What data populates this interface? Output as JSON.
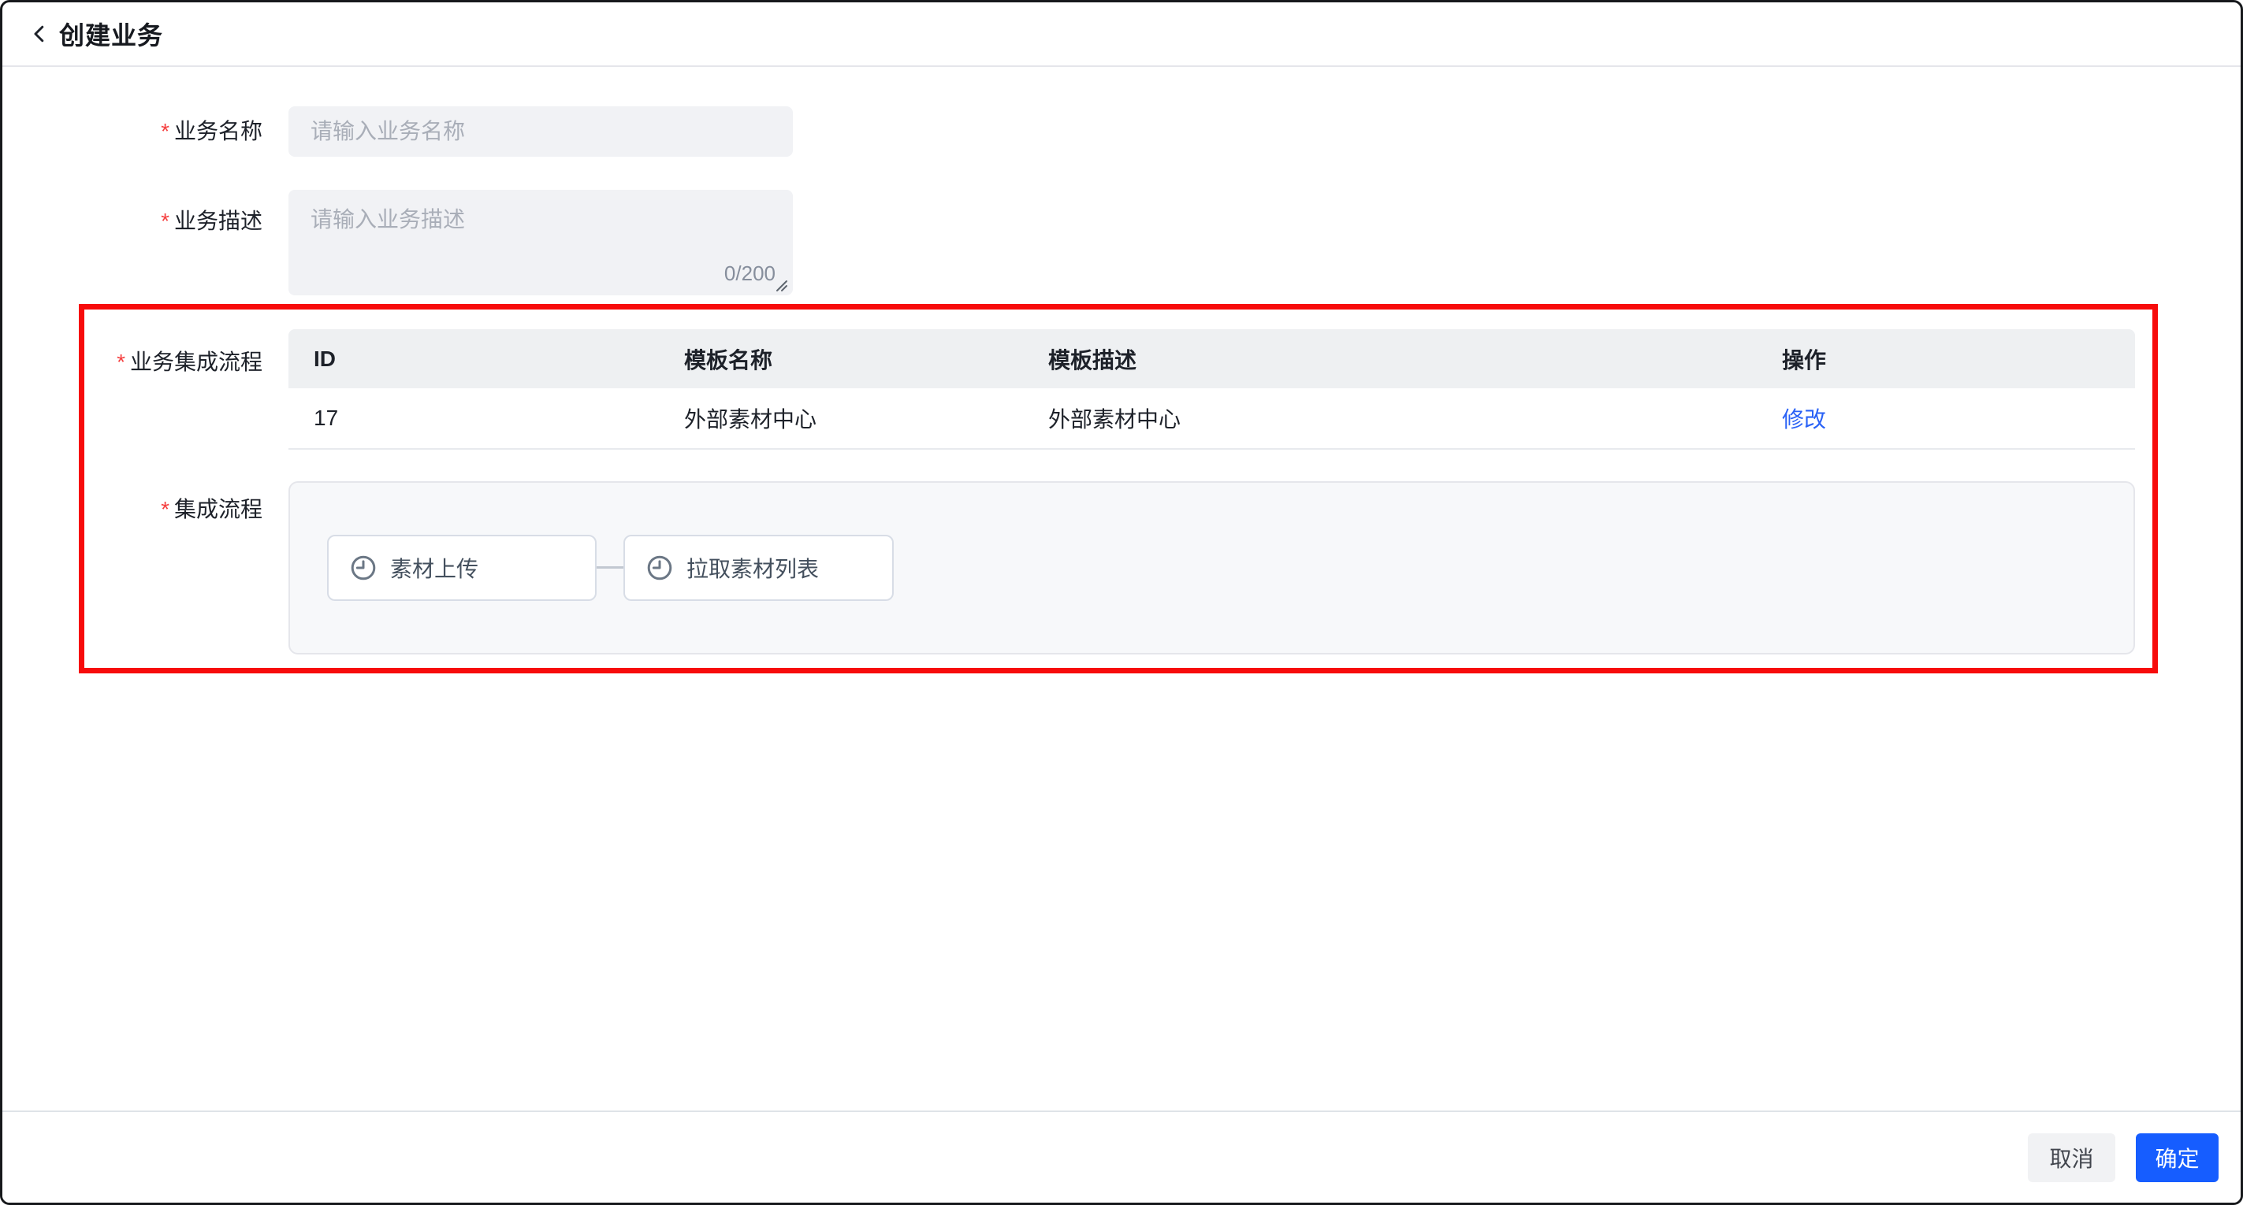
{
  "header": {
    "title": "创建业务"
  },
  "required_mark": "*",
  "form": {
    "name_field": {
      "label": "业务名称",
      "placeholder": "请输入业务名称",
      "value": ""
    },
    "desc_field": {
      "label": "业务描述",
      "placeholder": "请输入业务描述",
      "value": "",
      "counter": "0/200"
    },
    "integration_field": {
      "label": "业务集成流程",
      "table": {
        "headers": [
          "ID",
          "模板名称",
          "模板描述",
          "操作"
        ],
        "rows": [
          {
            "id": "17",
            "template_name": "外部素材中心",
            "template_desc": "外部素材中心",
            "action": "修改"
          }
        ]
      }
    },
    "flow_field": {
      "label": "集成流程",
      "nodes": [
        {
          "icon": "clock-icon",
          "label": "素材上传"
        },
        {
          "icon": "clock-icon",
          "label": "拉取素材列表"
        }
      ]
    }
  },
  "footer": {
    "cancel": "取消",
    "confirm": "确定"
  },
  "colors": {
    "primary_blue": "#165dff",
    "link_blue": "#2a62f6",
    "highlight_red": "#f70b0b",
    "asterisk_red": "#f53f3f",
    "input_bg": "#f1f2f5",
    "table_header_bg": "#eef0f2",
    "flow_panel_bg": "#f7f8fa"
  }
}
